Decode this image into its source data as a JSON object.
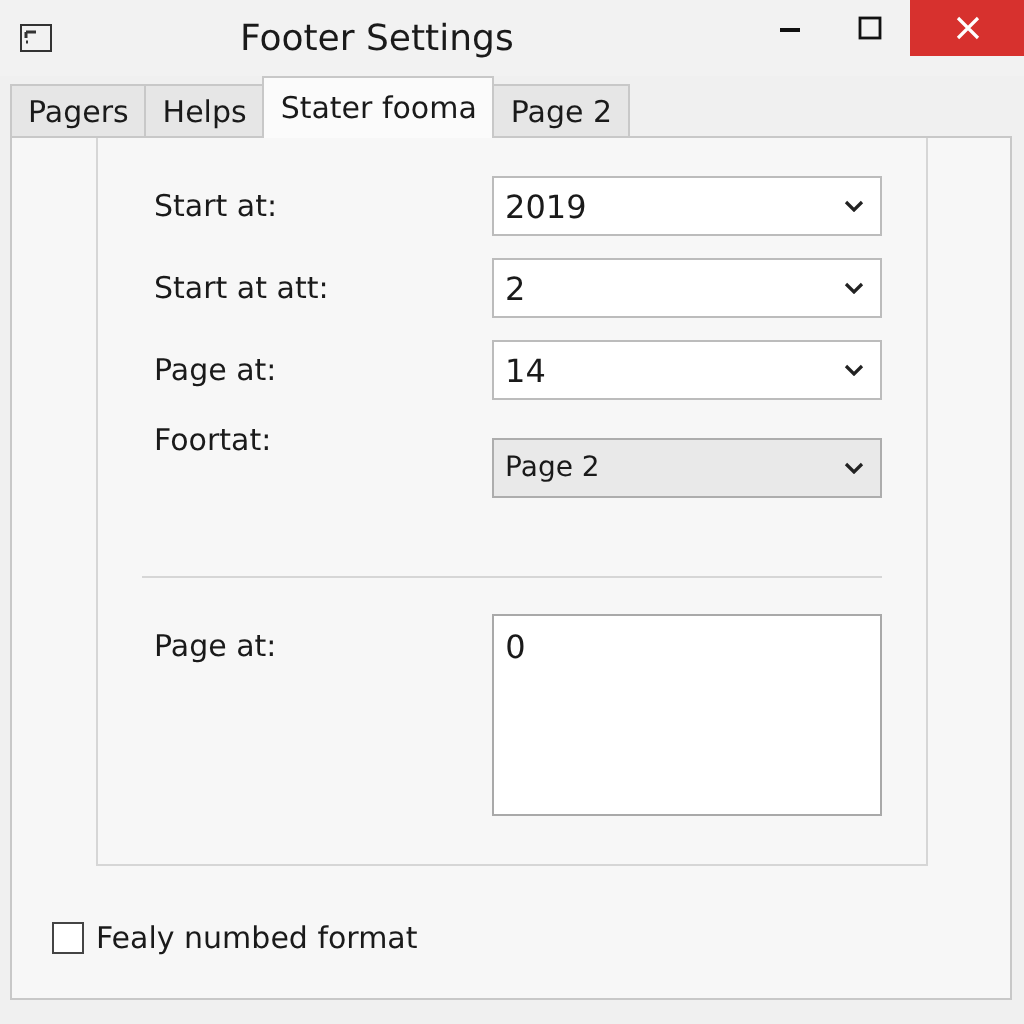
{
  "window": {
    "title": "Footer Settings"
  },
  "tabs": [
    {
      "label": "Pagers",
      "selected": false
    },
    {
      "label": "Helps",
      "selected": false
    },
    {
      "label": "Stater fooma",
      "selected": true
    },
    {
      "label": "Page 2",
      "selected": false
    }
  ],
  "fields": [
    {
      "label": "Start at:",
      "value": "2019",
      "kind": "combo"
    },
    {
      "label": "Start at att:",
      "value": "2",
      "kind": "combo"
    },
    {
      "label": "Page at:",
      "value": "14",
      "kind": "combo"
    },
    {
      "label": "Foortat:",
      "value": "Page 2",
      "kind": "dropdown"
    }
  ],
  "text_area": {
    "label": "Page at:",
    "value": "0"
  },
  "checkbox": {
    "label": "Fealy numbed format",
    "checked": false
  }
}
